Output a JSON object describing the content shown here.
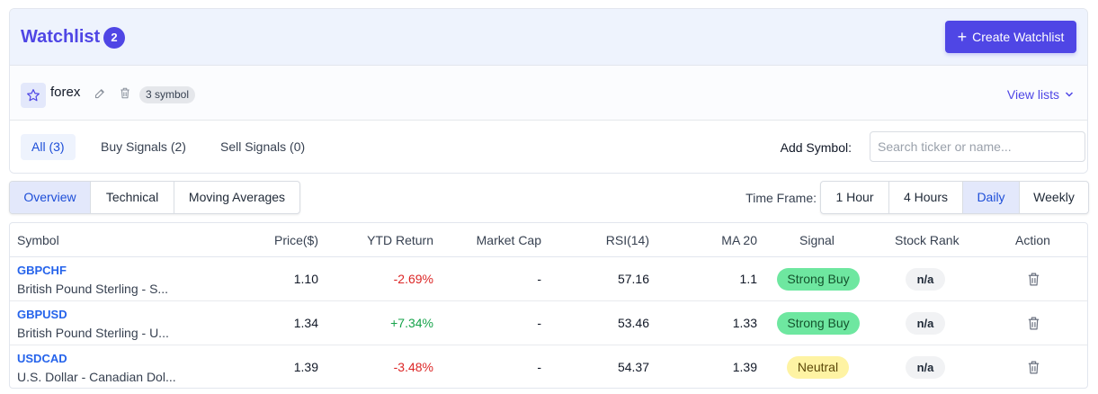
{
  "header": {
    "title": "Watchlist",
    "count": "2",
    "create_label": "Create Watchlist"
  },
  "list": {
    "name": "forex",
    "symbol_count": "3 symbol",
    "view_lists_label": "View lists"
  },
  "filters": {
    "all": "All (3)",
    "buy": "Buy Signals (2)",
    "sell": "Sell Signals (0)"
  },
  "add_symbol": {
    "label": "Add Symbol:",
    "placeholder": "Search ticker or name..."
  },
  "view_tabs": [
    "Overview",
    "Technical",
    "Moving Averages"
  ],
  "timeframe": {
    "label": "Time Frame:",
    "options": [
      "1 Hour",
      "4 Hours",
      "Daily",
      "Weekly"
    ],
    "selected": "Daily"
  },
  "table": {
    "headers": [
      "Symbol",
      "Price($)",
      "YTD Return",
      "Market Cap",
      "RSI(14)",
      "MA 20",
      "Signal",
      "Stock Rank",
      "Action"
    ],
    "rows": [
      {
        "ticker": "GBPCHF",
        "name": "British Pound Sterling - S...",
        "price": "1.10",
        "ytd": "-2.69%",
        "market_cap": "-",
        "rsi": "57.16",
        "ma20": "1.1",
        "signal": "Strong Buy",
        "rank": "n/a"
      },
      {
        "ticker": "GBPUSD",
        "name": "British Pound Sterling - U...",
        "price": "1.34",
        "ytd": "+7.34%",
        "market_cap": "-",
        "rsi": "53.46",
        "ma20": "1.33",
        "signal": "Strong Buy",
        "rank": "n/a"
      },
      {
        "ticker": "USDCAD",
        "name": "U.S. Dollar - Canadian Dol...",
        "price": "1.39",
        "ytd": "-3.48%",
        "market_cap": "-",
        "rsi": "54.37",
        "ma20": "1.39",
        "signal": "Neutral",
        "rank": "n/a"
      }
    ]
  },
  "colors": {
    "accent": "#4f46e5",
    "link": "#2563eb",
    "negative": "#dc2626",
    "positive": "#16a34a",
    "strong_buy": "#6ee7a0",
    "neutral": "#fef3a3"
  },
  "icons": {
    "create": "plus-icon",
    "list": "star-icon",
    "edit": "pencil-icon",
    "delete": "trash-icon",
    "dropdown": "chevron-down-icon"
  }
}
